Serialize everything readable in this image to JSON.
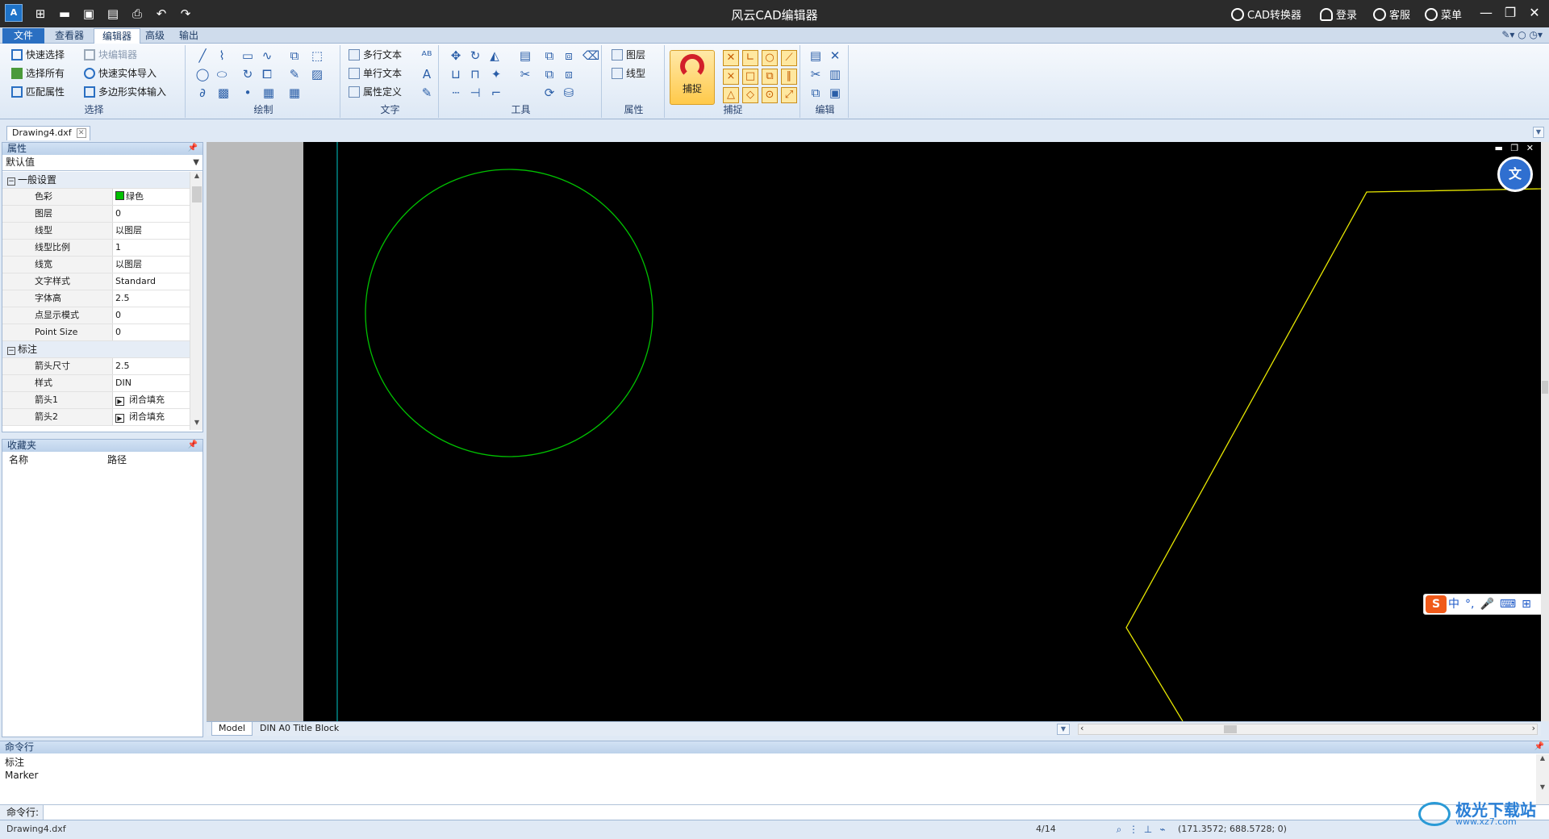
{
  "app": {
    "title": "风云CAD编辑器",
    "logo": "A",
    "links": {
      "converter": "CAD转换器",
      "login": "登录",
      "service": "客服",
      "menu": "菜单"
    }
  },
  "menu_tabs": [
    "文件",
    "查看器",
    "编辑器",
    "高级",
    "输出"
  ],
  "active_tab": "编辑器",
  "ribbon": {
    "select": {
      "label": "选择",
      "quick_select": "快速选择",
      "block_editor": "块编辑器",
      "select_all": "选择所有",
      "quick_import": "快速实体导入",
      "match_props": "匹配属性",
      "polygon_input": "多边形实体输入"
    },
    "draw": {
      "label": "绘制"
    },
    "text": {
      "label": "文字",
      "mtext": "多行文本",
      "stext": "单行文本",
      "attdef": "属性定义"
    },
    "tools": {
      "label": "工具"
    },
    "props": {
      "label": "属性",
      "layer": "图层",
      "linetype": "线型"
    },
    "snap": {
      "label": "捕捉",
      "button": "捕捉"
    },
    "edit": {
      "label": "编辑"
    }
  },
  "document": {
    "tab": "Drawing4.dxf"
  },
  "properties_panel": {
    "title": "属性",
    "combo": "默认值",
    "categories": [
      {
        "name": "一般设置",
        "rows": [
          {
            "name": "色彩",
            "value": "绿色"
          },
          {
            "name": "图层",
            "value": "0"
          },
          {
            "name": "线型",
            "value": "以图层"
          },
          {
            "name": "线型比例",
            "value": "1"
          },
          {
            "name": "线宽",
            "value": "以图层"
          },
          {
            "name": "文字样式",
            "value": "Standard"
          },
          {
            "name": "字体高",
            "value": "2.5"
          },
          {
            "name": "点显示模式",
            "value": "0"
          },
          {
            "name": "Point Size",
            "value": "0"
          }
        ]
      },
      {
        "name": "标注",
        "rows": [
          {
            "name": "箭头尺寸",
            "value": "2.5"
          },
          {
            "name": "样式",
            "value": "DIN"
          },
          {
            "name": "箭头1",
            "value": "闭合填充"
          },
          {
            "name": "箭头2",
            "value": "闭合填充"
          }
        ]
      }
    ]
  },
  "favorites_panel": {
    "title": "收藏夹",
    "col_name": "名称",
    "col_path": "路径"
  },
  "layout_tabs": [
    "Model",
    "DIN A0 Title Block"
  ],
  "command": {
    "title": "命令行",
    "log": [
      "标注",
      "Marker"
    ],
    "prompt": "命令行:",
    "input_value": ""
  },
  "status": {
    "file": "Drawing4.dxf",
    "page": "4/14",
    "coords": "(171.3572; 688.5728; 0)"
  },
  "ime": {
    "lang": "中"
  },
  "watermark": {
    "text": "极光下载站",
    "sub": "www.xz7.com"
  },
  "colors": {
    "circle": "#00c000",
    "polyline": "#e6e600",
    "guide": "#00c8c8",
    "canvas": "#000000"
  }
}
